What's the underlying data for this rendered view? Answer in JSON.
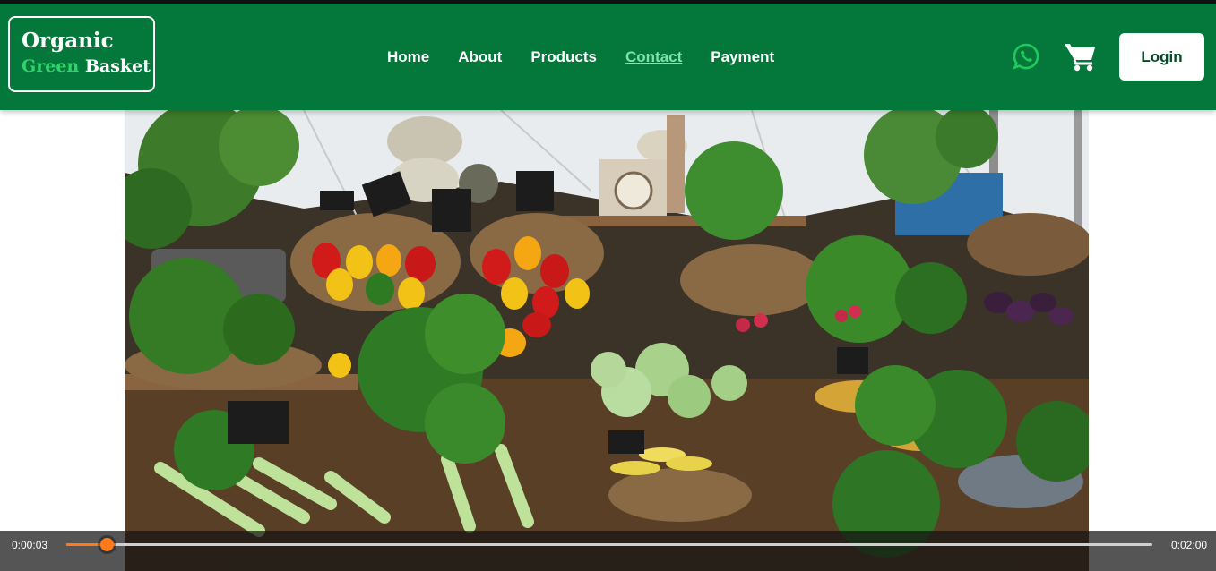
{
  "header": {
    "logo_line1": "Organic",
    "logo_word_green": "Green",
    "logo_word_basket": "Basket",
    "nav": [
      {
        "label": "Home",
        "active": false
      },
      {
        "label": "About",
        "active": false
      },
      {
        "label": "Products",
        "active": false
      },
      {
        "label": "Contact",
        "active": true
      },
      {
        "label": "Payment",
        "active": false
      }
    ],
    "whatsapp_icon": "whatsapp-icon",
    "cart_icon": "cart-icon",
    "login_label": "Login"
  },
  "video": {
    "current_time": "0:00:03",
    "duration": "0:02:00",
    "progress": 0.037
  },
  "colors": {
    "header_bg": "#04773a",
    "accent_green": "#2fd26b",
    "progress": "#ff7a1a"
  }
}
